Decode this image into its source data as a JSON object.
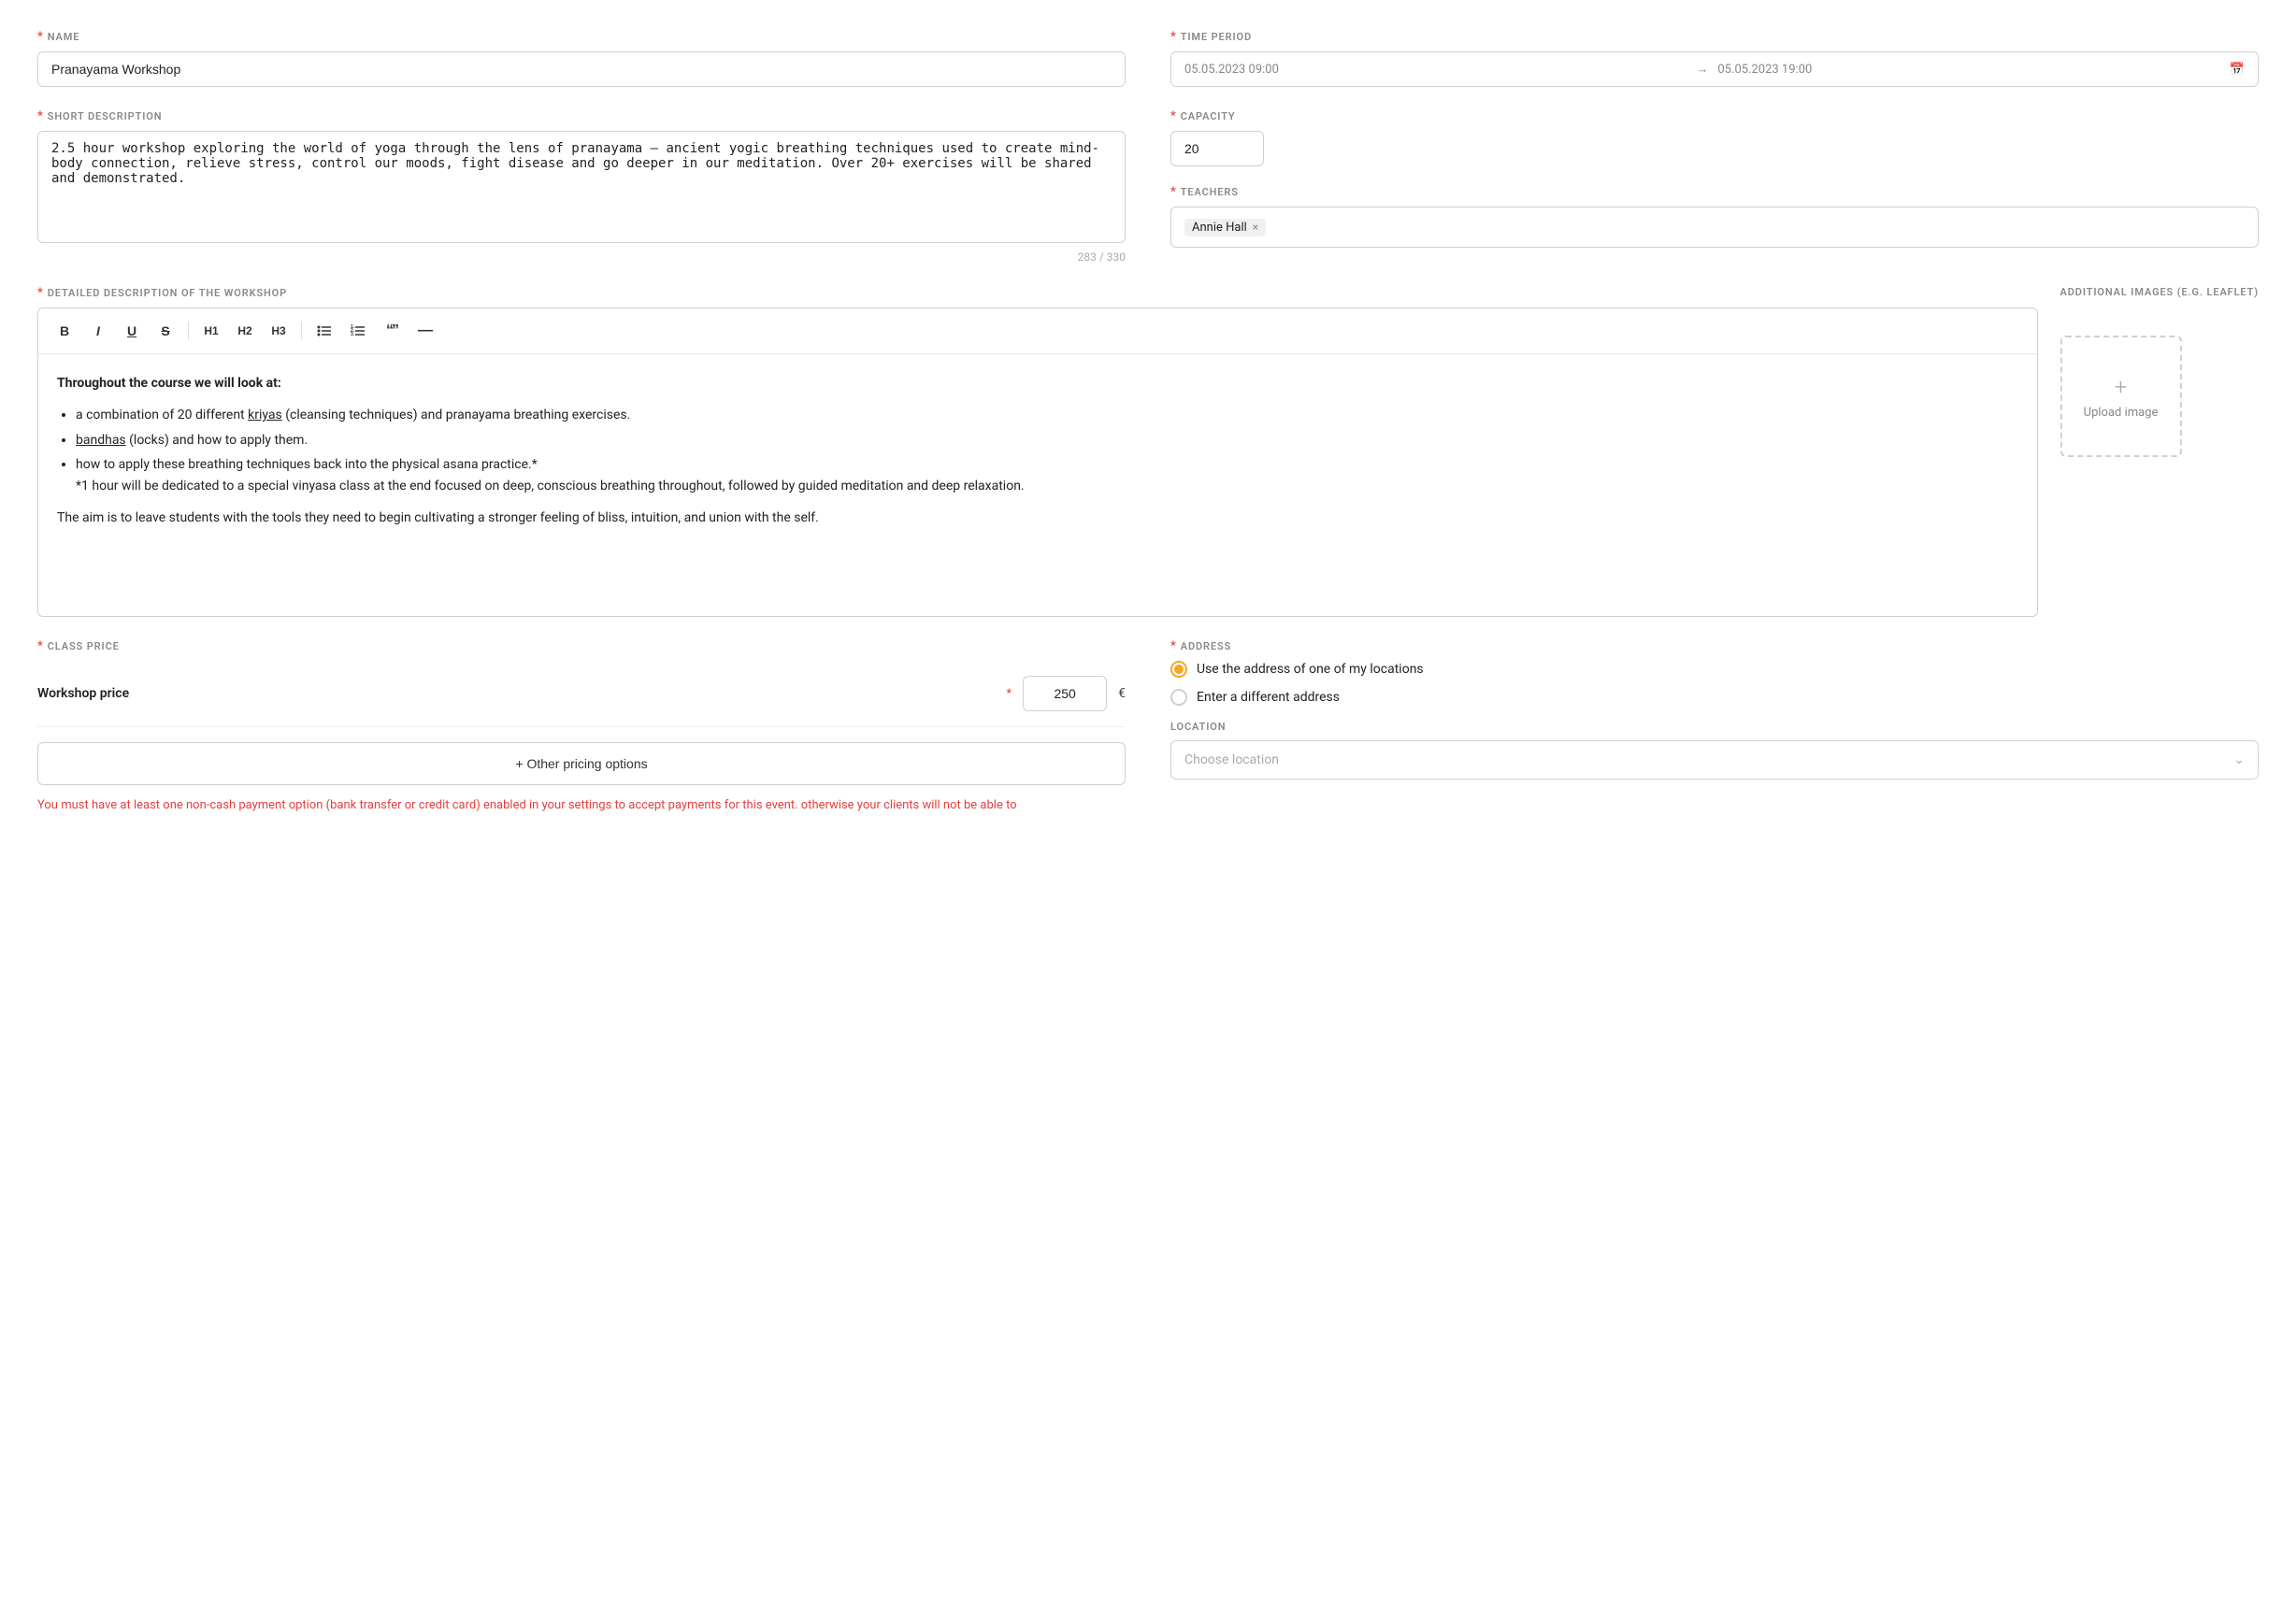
{
  "form": {
    "name": {
      "label": "NAME",
      "value": "Pranayama Workshop",
      "placeholder": ""
    },
    "short_description": {
      "label": "SHORT DESCRIPTION",
      "value": "2.5 hour workshop exploring the world of yoga through the lens of pranayama – ancient yogic breathing techniques used to create mind-body connection, relieve stress, control our moods, fight disease and go deeper in our meditation. Over 20+ exercises will be shared and demonstrated.",
      "counter": "283 / 330"
    },
    "time_period": {
      "label": "TIME PERIOD",
      "start": "05.05.2023 09:00",
      "end": "05.05.2023 19:00"
    },
    "capacity": {
      "label": "CAPACITY",
      "value": "20"
    },
    "teachers": {
      "label": "TEACHERS",
      "tags": [
        "Annie Hall"
      ]
    },
    "detailed_description": {
      "label": "DETAILED DESCRIPTION OF THE WORKSHOP",
      "toolbar": {
        "bold": "B",
        "italic": "I",
        "underline": "U",
        "strikethrough": "S",
        "h1": "H1",
        "h2": "H2",
        "h3": "H3",
        "bullet_list": "ul",
        "numbered_list": "ol",
        "quote": "\"\"",
        "divider": "—"
      },
      "content": {
        "heading": "Throughout the course we will look at:",
        "items": [
          "a combination of 20 different kriyas (cleansing techniques) and pranayama breathing exercises.",
          "bandhas (locks) and how to apply them.",
          "how to apply these breathing techniques back into the physical asana practice.*\n*1 hour will be dedicated to a special vinyasa class at the end focused on deep, conscious breathing throughout, followed by guided meditation and deep relaxation."
        ],
        "closing": "The aim is to leave students with the tools they need to begin cultivating a stronger feeling of bliss, intuition, and union with the self."
      }
    },
    "additional_images": {
      "label": "ADDITIONAL IMAGES (E.G. LEAFLET)",
      "upload_label": "Upload image"
    },
    "class_price": {
      "label": "CLASS PRICE",
      "workshop_price_label": "Workshop price",
      "workshop_price_value": "250",
      "currency": "€",
      "add_pricing_label": "+ Other pricing options"
    },
    "warning_text": "You must have at least one non-cash payment option (bank transfer or credit card) enabled in your settings to accept payments for this event. otherwise your clients will not be able to",
    "address": {
      "label": "ADDRESS",
      "options": [
        "Use the address of one of my locations",
        "Enter a different address"
      ],
      "selected_option": 0,
      "location_label": "LOCATION",
      "location_placeholder": "Choose location"
    }
  }
}
